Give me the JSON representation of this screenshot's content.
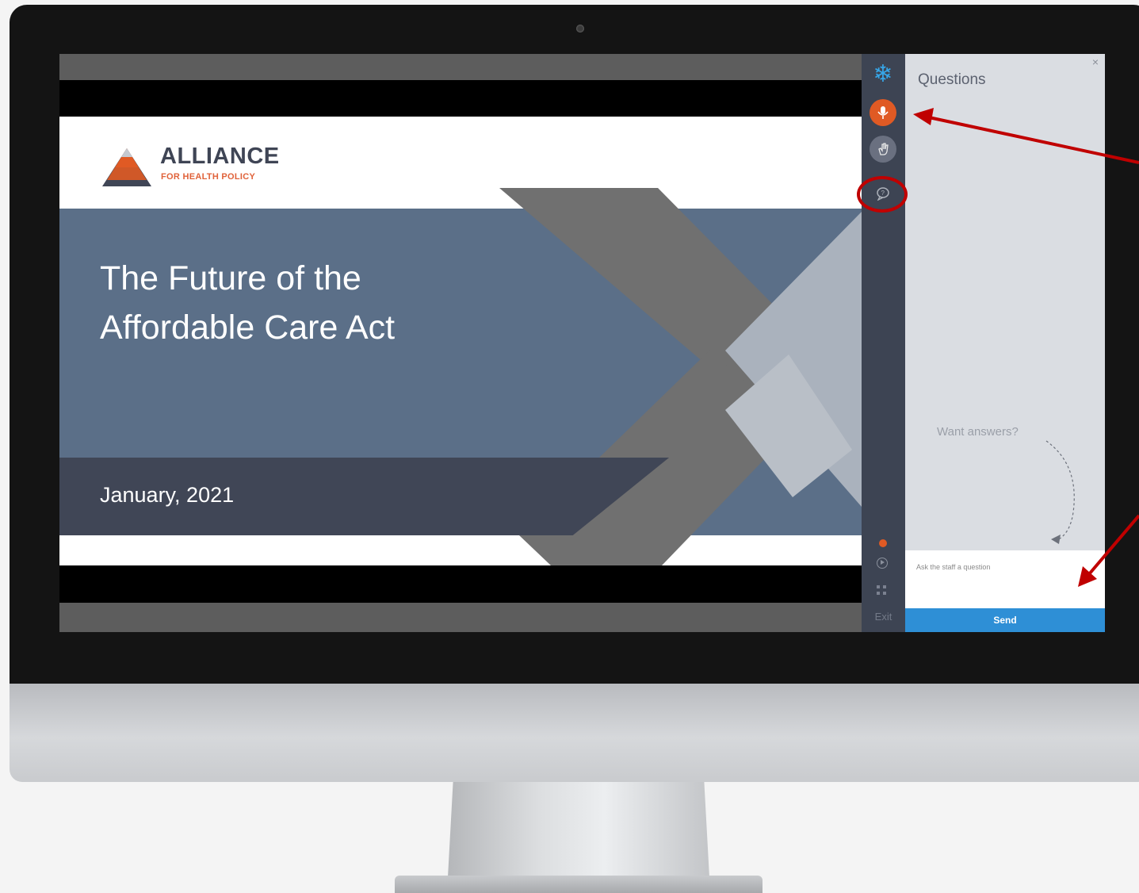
{
  "slide": {
    "logo": {
      "name": "ALLIANCE",
      "tagline": "FOR HEALTH POLICY"
    },
    "title_line1": "The Future of the",
    "title_line2": "Affordable Care Act",
    "date": "January, 2021"
  },
  "toolbar": {
    "items": [
      {
        "icon": "snowflake-icon"
      },
      {
        "icon": "microphone-icon",
        "active": true
      },
      {
        "icon": "hand-raise-icon"
      },
      {
        "icon": "question-bubble-icon",
        "highlighted": true
      }
    ],
    "exit_label": "Exit"
  },
  "questions_panel": {
    "title": "Questions",
    "close_glyph": "×",
    "prompt": "Want answers?",
    "input_placeholder": "Ask the staff a question",
    "send_label": "Send"
  },
  "colors": {
    "accent_orange": "#e05a24",
    "send_blue": "#2e8fd6",
    "annotation_red": "#c00000",
    "slide_blue": "#5b6f88"
  }
}
